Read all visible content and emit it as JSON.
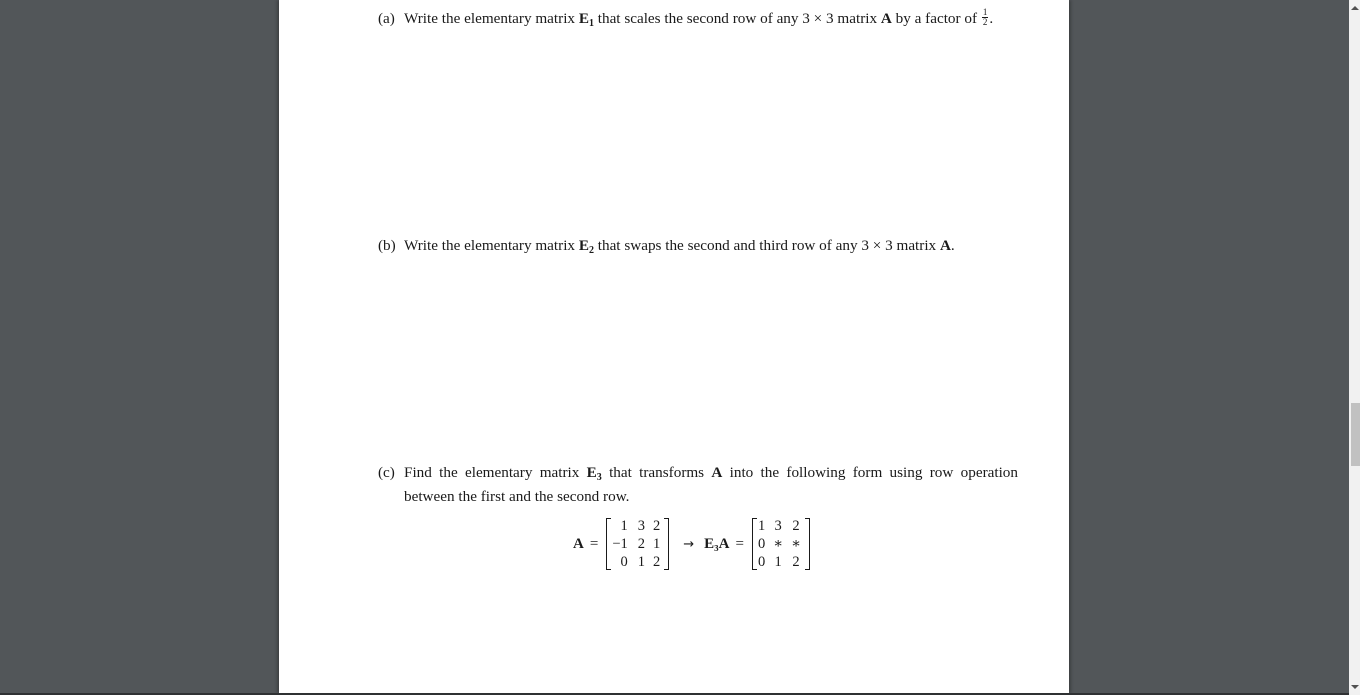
{
  "document": {
    "items": [
      {
        "label": "(a)",
        "text_1": "Write the elementary matrix ",
        "matrix_name": "E",
        "matrix_sub": "1",
        "text_2": " that scales the second row of any 3 × 3 matrix ",
        "matrix_A": "A",
        "text_3": " by a factor of ",
        "frac_num": "1",
        "frac_den": "2",
        "text_4": "."
      },
      {
        "label": "(b)",
        "text_1": "Write the elementary matrix ",
        "matrix_name": "E",
        "matrix_sub": "2",
        "text_2": " that swaps the second and third row of any 3 × 3 matrix ",
        "matrix_A": "A",
        "text_3": "."
      },
      {
        "label": "(c)",
        "text_1": "Find the elementary matrix ",
        "matrix_name": "E",
        "matrix_sub": "3",
        "text_2": " that transforms ",
        "matrix_A": "A",
        "text_3": " into the following form using row operation between the first and the second row."
      }
    ],
    "equation": {
      "lhs": "A",
      "equals": "=",
      "matrix_A": [
        [
          "1",
          "3",
          "2"
        ],
        [
          "−1",
          "2",
          "1"
        ],
        [
          "0",
          "1",
          "2"
        ]
      ],
      "arrow": "→",
      "rhs_label": "E₃A",
      "rhs_equals": "=",
      "matrix_E3A": [
        [
          "1",
          "3",
          "2"
        ],
        [
          "0",
          "∗",
          "∗"
        ],
        [
          "0",
          "1",
          "2"
        ]
      ]
    }
  },
  "colors": {
    "viewer_background": "#525659",
    "page_background": "#ffffff",
    "scrollbar_track": "#f1f1f1",
    "scrollbar_thumb": "#c1c1c1"
  }
}
